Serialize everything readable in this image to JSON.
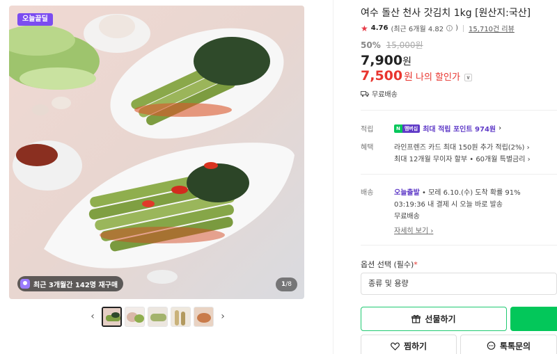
{
  "image": {
    "badge": "오늘끝딜",
    "social_proof": "최근 3개월간 142명 재구매",
    "counter_current": "1",
    "counter_total": "/8",
    "thumbnail_count": 5
  },
  "product": {
    "title": "여수 돌산 천사 갓김치 1kg [원산지:국산]",
    "rating": "4.76",
    "rating_recent": "(최근 6개월 4.82",
    "rating_recent_end": ")",
    "reviews": "15,710건 리뷰",
    "discount_pct": "50%",
    "original_price": "15,000원",
    "price": "7,900",
    "price_unit": "원",
    "my_price": "7,500",
    "my_price_unit": "원",
    "my_price_label": "나의 할인가",
    "free_shipping": "무료배송"
  },
  "point": {
    "label": "적립",
    "npay_a": "N",
    "npay_b": "멤버십",
    "text": "최대 적립 포인트 974원"
  },
  "benefits": {
    "label": "혜택",
    "line1": "라인프렌즈 카드 최대 150원 추가 적립(2%)",
    "line2": "최대 12개월 무이자 할부 • 60개월 특별금리"
  },
  "delivery": {
    "label": "배송",
    "today": "오늘출발",
    "eta": " • 모레 6.10.(수) 도착 확률 91%",
    "deadline": "03:19:36  내 결제 시 오늘 바로 발송",
    "fee": "무료배송",
    "detail": "자세히 보기"
  },
  "options": {
    "label": "옵션 선택 (필수)",
    "required_mark": "*",
    "placeholder": "종류 및 용량"
  },
  "actions": {
    "gift": "선물하기",
    "zzim": "찜하기",
    "talk": "톡톡문의"
  },
  "colors": {
    "accent_green": "#03c75a",
    "price_red": "#e8352f",
    "npay_purple": "#5f3ac7"
  }
}
